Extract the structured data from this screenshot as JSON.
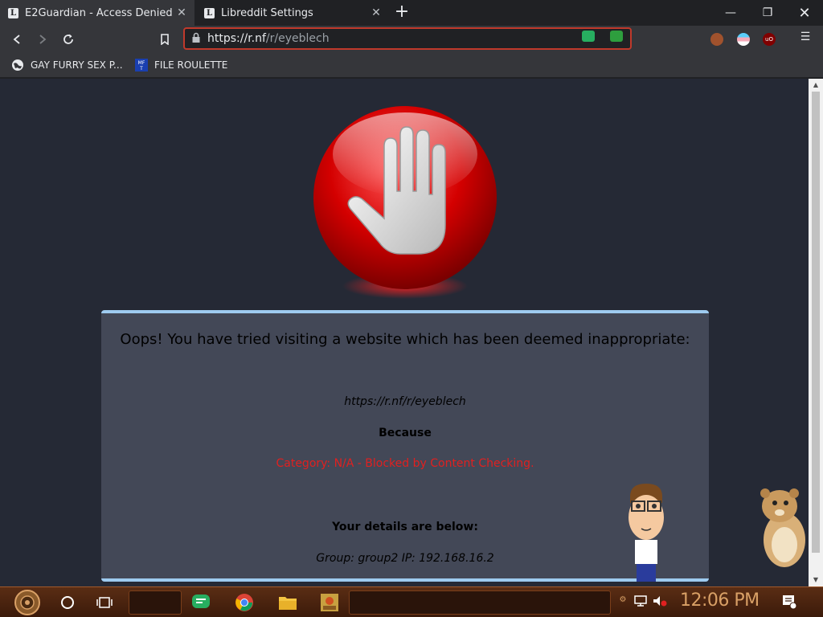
{
  "tabs": [
    {
      "title": "E2Guardian - Access Denied",
      "favicon": "L",
      "active": true
    },
    {
      "title": "Libreddit Settings",
      "favicon": "L",
      "active": false
    }
  ],
  "toolbar": {
    "url_scheme": "https://",
    "url_host": "r.nf",
    "url_path": "/r/eyeblech"
  },
  "bookmarks": [
    {
      "label": "GAY FURRY SEX P...",
      "icon": "globe-icon"
    },
    {
      "label": "FILE ROULETTE",
      "icon": "file-roulette-icon"
    }
  ],
  "page": {
    "headline": "Oops! You have tried visiting a website which has been deemed inappropriate:",
    "blocked_url": "https://r.nf/r/eyeblech",
    "because": "Because",
    "reason": "Category: N/A - Blocked by Content Checking.",
    "details_heading": "Your details are below:",
    "details": "Group: group2   IP: 192.168.16.2"
  },
  "taskbar": {
    "clock": "12:06 PM"
  },
  "colors": {
    "accent_border": "#9ecbf0",
    "reason_red": "#e02020",
    "page_bg": "#252935",
    "panel_bg": "#434857",
    "clock": "#d9a066"
  }
}
